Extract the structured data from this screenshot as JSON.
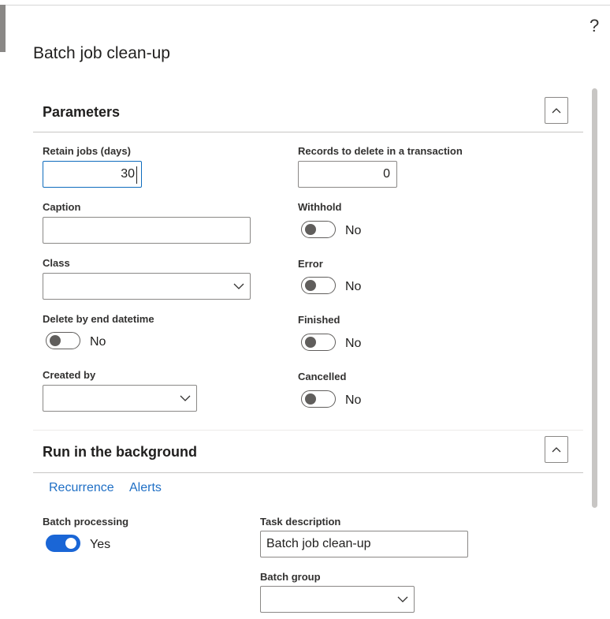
{
  "help_label": "?",
  "page_title": "Batch job clean-up",
  "parameters": {
    "title": "Parameters",
    "retain_jobs": {
      "label": "Retain jobs (days)",
      "value": "30"
    },
    "records_to_delete": {
      "label": "Records to delete in a transaction",
      "value": "0"
    },
    "caption": {
      "label": "Caption",
      "value": ""
    },
    "withhold": {
      "label": "Withhold",
      "state": "No"
    },
    "class": {
      "label": "Class",
      "value": ""
    },
    "error": {
      "label": "Error",
      "state": "No"
    },
    "delete_by_end_datetime": {
      "label": "Delete by end datetime",
      "state": "No"
    },
    "finished": {
      "label": "Finished",
      "state": "No"
    },
    "created_by": {
      "label": "Created by",
      "value": ""
    },
    "cancelled": {
      "label": "Cancelled",
      "state": "No"
    }
  },
  "background": {
    "title": "Run in the background",
    "tabs": [
      "Recurrence",
      "Alerts"
    ],
    "batch_processing": {
      "label": "Batch processing",
      "state": "Yes"
    },
    "task_description": {
      "label": "Task description",
      "value": "Batch job clean-up"
    },
    "batch_group": {
      "label": "Batch group",
      "value": ""
    }
  },
  "colors": {
    "accent": "#1a66d6",
    "link": "#1f6fc5",
    "focus": "#0f6cbd"
  }
}
